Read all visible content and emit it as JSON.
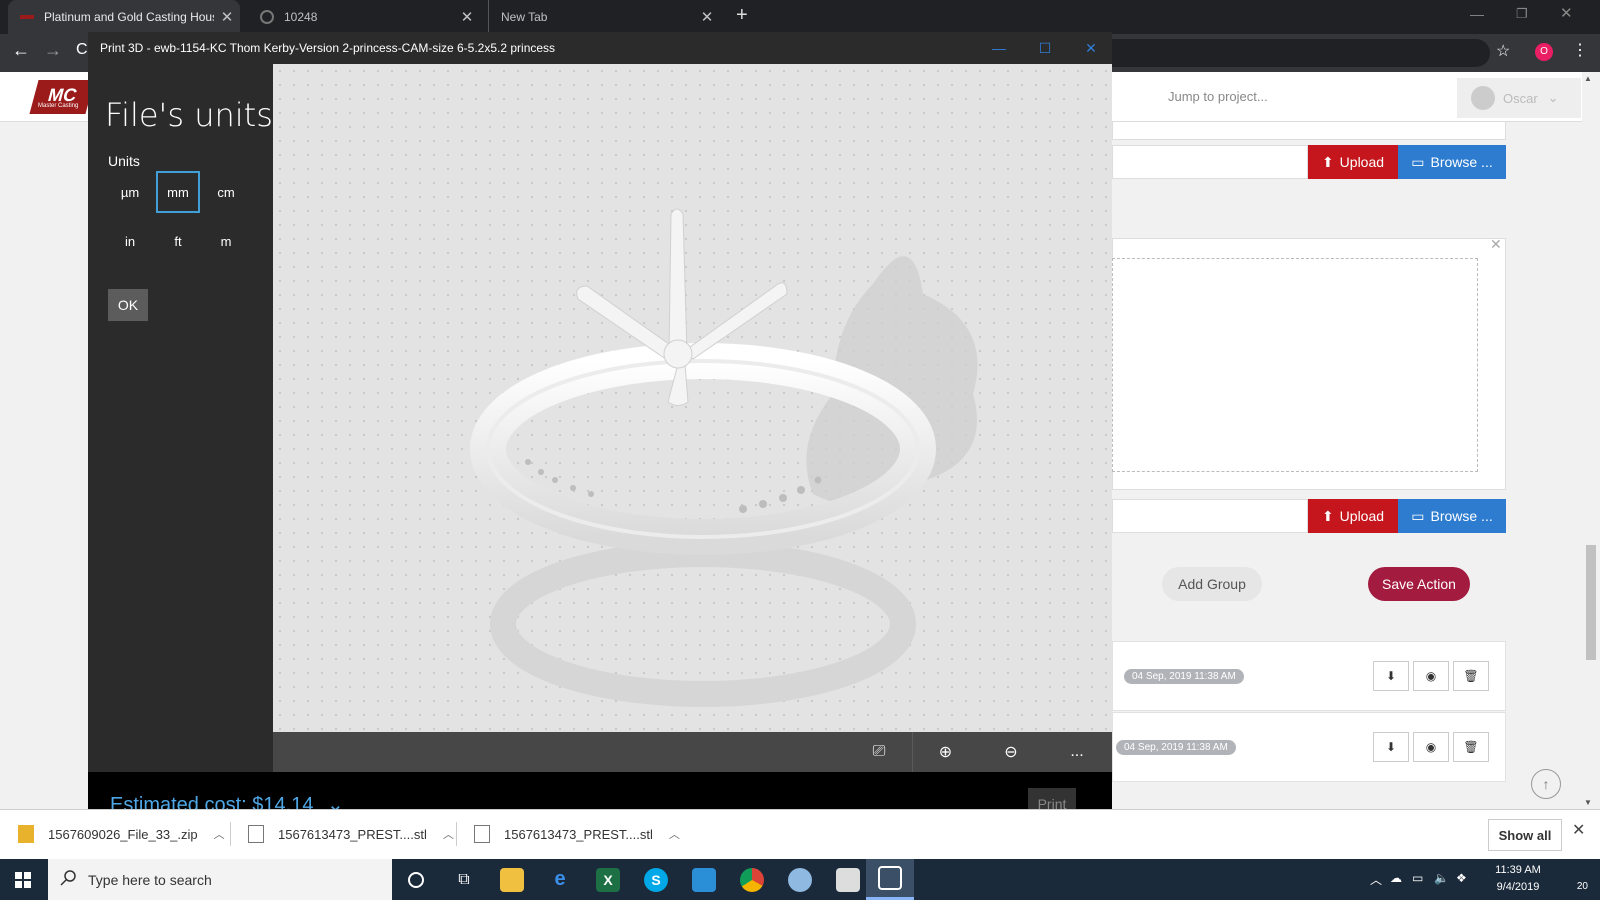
{
  "browser": {
    "tabs": [
      {
        "title": "Platinum and Gold Casting House"
      },
      {
        "title": "10248"
      },
      {
        "title": "New Tab"
      }
    ],
    "new_tab": "+",
    "profile_initial": "O"
  },
  "site": {
    "logo_text": "MC",
    "logo_sub": "Master Casting",
    "jump_placeholder": "Jump to project...",
    "user_name": "Oscar",
    "upload_label": "Upload",
    "browse_label": "Browse ...",
    "add_group_label": "Add Group",
    "save_action_label": "Save Action",
    "files": [
      {
        "timestamp": "04 Sep, 2019 11:38 AM"
      },
      {
        "timestamp": "04 Sep, 2019 11:38 AM"
      }
    ]
  },
  "print3d": {
    "window_title": "Print 3D - ewb-1154-KC Thom Kerby-Version 2-princess-CAM-size 6-5.2x5.2 princess",
    "panel_title": "File's units",
    "units_label": "Units",
    "units": [
      {
        "label": "µm",
        "selected": false
      },
      {
        "label": "mm",
        "selected": true
      },
      {
        "label": "cm",
        "selected": false
      },
      {
        "label": "in",
        "selected": false
      },
      {
        "label": "ft",
        "selected": false
      },
      {
        "label": "m",
        "selected": false
      }
    ],
    "ok_label": "OK",
    "estimated_cost": "Estimated cost: $14.14",
    "print_label": "Print",
    "more_label": "...",
    "accent_color": "#3f9fd6"
  },
  "downloads": {
    "items": [
      {
        "name": "1567609026_File_33_.zip"
      },
      {
        "name": "1567613473_PREST....stl"
      },
      {
        "name": "1567613473_PREST....stl"
      }
    ],
    "show_all_label": "Show all"
  },
  "taskbar": {
    "search_placeholder": "Type here to search",
    "time": "11:39 AM",
    "date": "9/4/2019",
    "notification_count": "20",
    "pinned_icons": [
      "cortana-icon",
      "task-view-icon",
      "file-explorer-icon",
      "edge-icon",
      "excel-icon",
      "skype-icon",
      "photos-icon",
      "chrome-icon",
      "paint-icon",
      "app-icon",
      "print3d-icon"
    ]
  }
}
